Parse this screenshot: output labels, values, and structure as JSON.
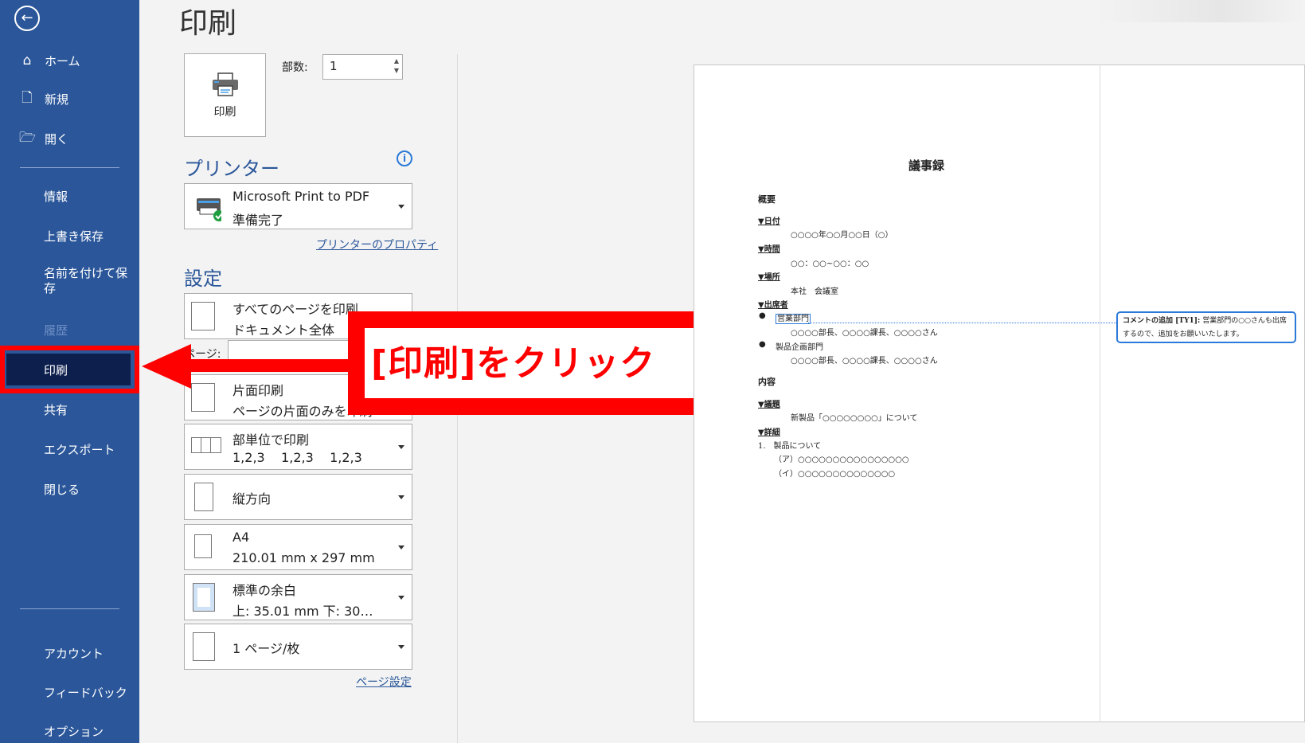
{
  "sidebar": {
    "items": [
      {
        "label": "ホーム",
        "icon": "home-icon"
      },
      {
        "label": "新規",
        "icon": "new-document-icon"
      },
      {
        "label": "開く",
        "icon": "open-folder-icon"
      },
      {
        "label": "情報"
      },
      {
        "label": "上書き保存"
      },
      {
        "label": "名前を付けて保存"
      },
      {
        "label": "履歴",
        "disabled": true
      },
      {
        "label": "印刷",
        "active": true
      },
      {
        "label": "共有"
      },
      {
        "label": "エクスポート"
      },
      {
        "label": "閉じる"
      },
      {
        "label": "アカウント"
      },
      {
        "label": "フィードバック"
      },
      {
        "label": "オプション"
      }
    ],
    "saveas_line1": "名前を付けて保",
    "saveas_line2": "存",
    "accent_color": "#2b579a",
    "active_color": "#0d1f4d"
  },
  "main": {
    "title": "印刷",
    "print_button_label": "印刷",
    "copies_label": "部数:",
    "copies_value": "1",
    "printer_heading": "プリンター",
    "printer_name": "Microsoft Print to PDF",
    "printer_status": "準備完了",
    "printer_properties_link": "プリンターのプロパティ",
    "settings_heading": "設定",
    "settings": [
      {
        "line1": "すべてのページを印刷",
        "line2": "ドキュメント全体"
      },
      {
        "line1": "片面印刷",
        "line2": "ページの片面のみを印刷"
      },
      {
        "line1": "部単位で印刷",
        "line2": "1,2,3    1,2,3    1,2,3"
      },
      {
        "line1": "縦方向"
      },
      {
        "line1": "A4",
        "line2": "210.01 mm x 297 mm"
      },
      {
        "line1": "標準の余白",
        "line2": "上: 35.01 mm 下: 30…"
      },
      {
        "line1": "1 ページ/枚"
      }
    ],
    "pages_label": "ページ:",
    "page_setup_link": "ページ設定"
  },
  "callout": {
    "text": "[印刷]をクリック",
    "color": "#ff0000"
  },
  "preview": {
    "title": "議事録",
    "overview": "概要",
    "date_label": "▼日付",
    "date_value": "○○○○年○○月○○日（○）",
    "time_label": "▼時間",
    "time_value": "○○：○○~○○：○○",
    "place_label": "▼場所",
    "place_value": "本社　会議室",
    "attendees_label": "▼出席者",
    "dept1": "営業部門",
    "dept1_members": "○○○○部長、○○○○課長、○○○○さん",
    "dept2": "製品企画部門",
    "dept2_members": "○○○○部長、○○○○課長、○○○○さん",
    "content": "内容",
    "agenda_label": "▼議題",
    "agenda_value": "新製品「○○○○○○○○」について",
    "detail_label": "▼詳細",
    "detail_1": "1.　製品について",
    "detail_a": "（ア）○○○○○○○○○○○○○○○○",
    "detail_b": "（イ）○○○○○○○○○○○○○○",
    "comment_author": "コメントの追加 [TY1]:",
    "comment_text": " 営業部門の○○さんも出席するので、追加をお願いいたします。"
  }
}
